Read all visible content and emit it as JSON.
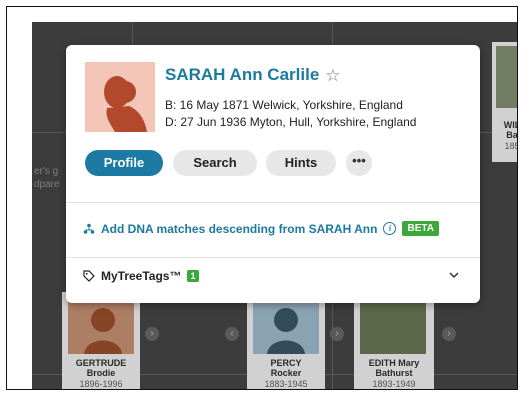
{
  "person": {
    "name": "SARAH Ann Carlile",
    "birth": "B: 16 May 1871 Welwick, Yorkshire, England",
    "death": "D: 27 Jun 1936 Myton, Hull, Yorkshire, England"
  },
  "actions": {
    "profile": "Profile",
    "search": "Search",
    "hints": "Hints",
    "more": "•••"
  },
  "dna": {
    "link": "Add DNA matches descending from SARAH Ann",
    "beta": "BETA"
  },
  "tags": {
    "label": "MyTreeTags™",
    "count": "1"
  },
  "background": {
    "left_snippet_1": "er's g",
    "left_snippet_2": "dpare",
    "right_card_name_1": "WIL",
    "right_card_name_2": "Ba",
    "right_card_year": "185",
    "cards": [
      {
        "name1": "GERTRUDE",
        "name2": "Brodie",
        "years": "1896-1996"
      },
      {
        "name1": "PERCY",
        "name2": "Rocker",
        "years": "1883-1945"
      },
      {
        "name1": "EDITH Mary",
        "name2": "Bathurst",
        "years": "1893-1949"
      }
    ]
  },
  "colors": {
    "accent": "#1b7a9e",
    "primary_button": "#1c7aa3",
    "beta_green": "#3aa83a",
    "tree_bg": "#4a4a4a"
  }
}
